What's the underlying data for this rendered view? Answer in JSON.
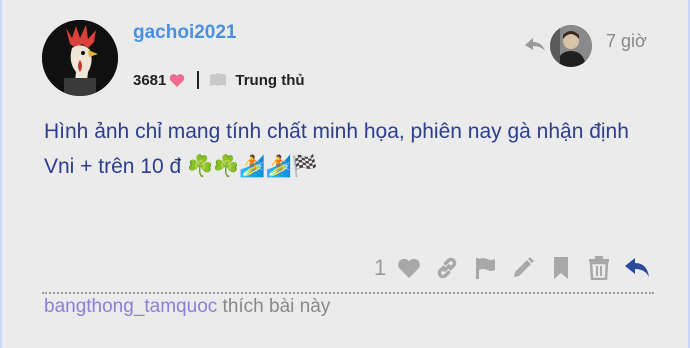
{
  "post": {
    "username": "gachoi2021",
    "score": "3681",
    "badge": "Trung thủ",
    "time": "7 giờ",
    "body_text": "Hình ảnh chỉ mang tính chất minh họa, phiên nay gà nhận định Vni + trên 10 đ",
    "body_emojis": "☘️☘️🏄🏄🏁",
    "like_count": "1",
    "liked_by": "bangthong_tamquoc",
    "liked_suffix": "thích bài này"
  },
  "icons": {
    "heart_color": "#f06b8f",
    "action_icon_color": "#a8a8a8",
    "reply_color": "#2c4a9a"
  }
}
